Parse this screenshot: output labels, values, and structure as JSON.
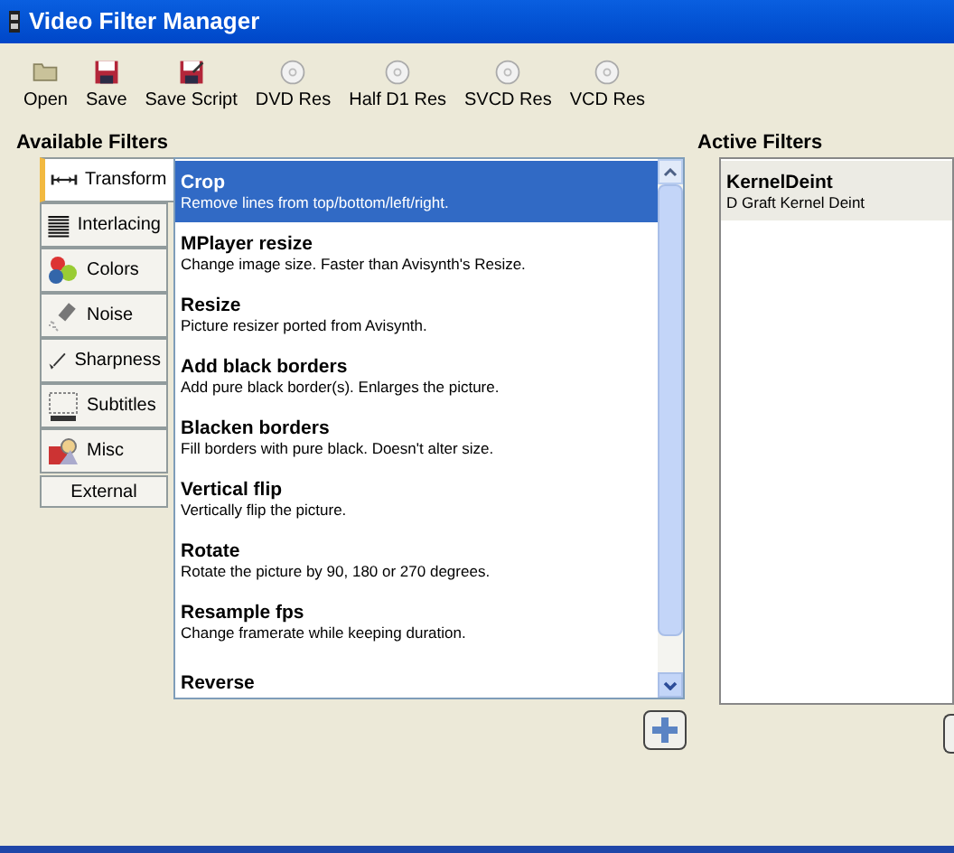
{
  "window": {
    "title": "Video Filter Manager"
  },
  "toolbar": [
    {
      "label": "Open",
      "kind": "folder"
    },
    {
      "label": "Save",
      "kind": "disk"
    },
    {
      "label": "Save Script",
      "kind": "script"
    },
    {
      "label": "DVD Res",
      "kind": "disc"
    },
    {
      "label": "Half D1 Res",
      "kind": "disc"
    },
    {
      "label": "SVCD Res",
      "kind": "disc"
    },
    {
      "label": "VCD Res",
      "kind": "disc"
    }
  ],
  "available_filters": {
    "heading": "Available Filters",
    "tabs": [
      {
        "label": "Transform",
        "kind": "transform",
        "selected": true
      },
      {
        "label": "Interlacing",
        "kind": "interlacing",
        "selected": false
      },
      {
        "label": "Colors",
        "kind": "colors",
        "selected": false
      },
      {
        "label": "Noise",
        "kind": "noise",
        "selected": false
      },
      {
        "label": "Sharpness",
        "kind": "sharpness",
        "selected": false
      },
      {
        "label": "Subtitles",
        "kind": "subtitles",
        "selected": false
      },
      {
        "label": "Misc",
        "kind": "misc",
        "selected": false
      },
      {
        "label": "External",
        "kind": "plain",
        "selected": false
      }
    ],
    "filters": [
      {
        "name": "Crop",
        "description": "Remove lines from top/bottom/left/right.",
        "selected": true
      },
      {
        "name": "MPlayer resize",
        "description": "Change image size. Faster than Avisynth's Resize.",
        "selected": false
      },
      {
        "name": "Resize",
        "description": "Picture resizer ported from Avisynth.",
        "selected": false
      },
      {
        "name": "Add black borders",
        "description": "Add pure black border(s). Enlarges the picture.",
        "selected": false
      },
      {
        "name": "Blacken borders",
        "description": "Fill borders with pure black. Doesn't alter size.",
        "selected": false
      },
      {
        "name": "Vertical flip",
        "description": "Vertically flip the picture.",
        "selected": false
      },
      {
        "name": "Rotate",
        "description": "Rotate the picture by 90, 180 or 270 degrees.",
        "selected": false
      },
      {
        "name": "Resample fps",
        "description": "Change framerate while keeping duration.",
        "selected": false
      },
      {
        "name": "Reverse",
        "selected": false
      }
    ]
  },
  "active_filters": {
    "heading": "Active Filters",
    "filters": [
      {
        "name": "KernelDeint",
        "description": "D Graft Kernel Deint",
        "selected": true
      }
    ]
  }
}
